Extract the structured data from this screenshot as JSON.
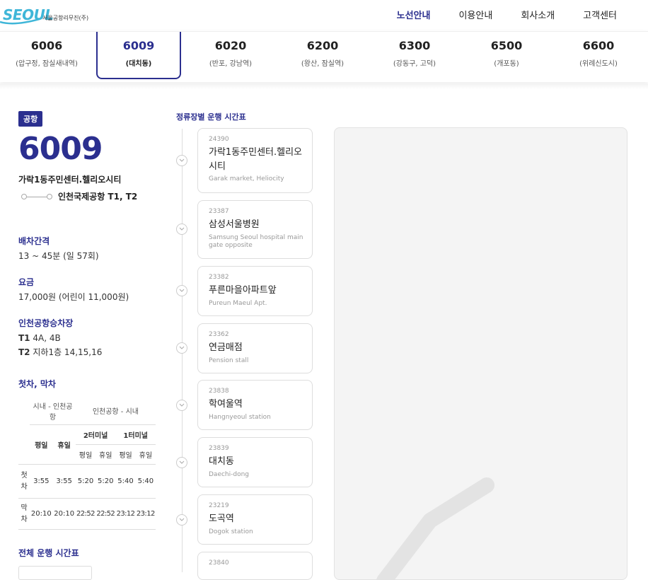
{
  "header": {
    "logo_text": "SEOUL",
    "logo_sub": "서울공항리무진(주)",
    "nav": [
      "노선안내",
      "이용안내",
      "회사소개",
      "고객센터"
    ],
    "active_nav": 0,
    "brand_color": "#2b2f8f",
    "logo_color": "#3fb6d8"
  },
  "routes": [
    {
      "num": "6006",
      "desc": "(압구정, 잠실새내역)"
    },
    {
      "num": "6009",
      "desc": "(대치동)"
    },
    {
      "num": "6020",
      "desc": "(반포, 강남역)"
    },
    {
      "num": "6200",
      "desc": "(왕산, 잠실역)"
    },
    {
      "num": "6300",
      "desc": "(강동구, 고덕)"
    },
    {
      "num": "6500",
      "desc": "(개포동)"
    },
    {
      "num": "6600",
      "desc": "(위례신도시)"
    }
  ],
  "active_route": 1,
  "info": {
    "badge": "공항",
    "route_num": "6009",
    "from": "가락1동주민센터.헬리오시티",
    "to": "인천국제공항 T1, T2",
    "interval_title": "배차간격",
    "interval_text": "13 ~ 45분 (일 57회)",
    "fare_title": "요금",
    "fare_text": "17,000원 (어린이 11,000원)",
    "platform_title": "인천공항승차장",
    "platform_t1_label": "T1",
    "platform_t1": " 4A, 4B",
    "platform_t2_label": "T2",
    "platform_t2": " 지하1층 14,15,16",
    "first_last_title": "첫차, 막차",
    "table": {
      "h_city_airport": "시내 - 인천공항",
      "h_airport_city": "인천공항 - 시내",
      "h_t2": "2터미널",
      "h_t1": "1터미널",
      "weekday": "평일",
      "holiday": "휴일",
      "first_label": "첫차",
      "last_label": "막차",
      "first": [
        "3:55",
        "3:55",
        "5:20",
        "5:20",
        "5:40",
        "5:40"
      ],
      "last": [
        "20:10",
        "20:10",
        "22:52",
        "22:52",
        "23:12",
        "23:12"
      ]
    },
    "full_timetable_title": "전체 운행 시간표"
  },
  "stops_title": "정류장별 운행 시간표",
  "stops": [
    {
      "id": "24390",
      "kr": "가락1동주민센터.헬리오시티",
      "en": "Garak market, Heliocity"
    },
    {
      "id": "23387",
      "kr": "삼성서울병원",
      "en": "Samsung Seoul hospital main gate opposite"
    },
    {
      "id": "23382",
      "kr": "푸른마을아파트앞",
      "en": "Pureun Maeul Apt."
    },
    {
      "id": "23362",
      "kr": "연금매점",
      "en": "Pension stall"
    },
    {
      "id": "23838",
      "kr": "학여울역",
      "en": "Hangnyeoul station"
    },
    {
      "id": "23839",
      "kr": "대치동",
      "en": "Daechi-dong"
    },
    {
      "id": "23219",
      "kr": "도곡역",
      "en": "Dogok station"
    },
    {
      "id": "23840",
      "kr": "",
      "en": ""
    }
  ]
}
